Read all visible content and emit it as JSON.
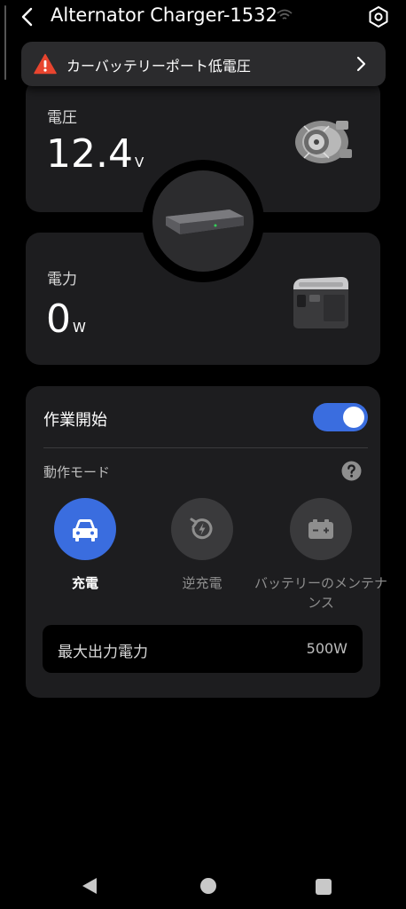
{
  "header": {
    "title": "Alternator Charger-1532"
  },
  "warning": {
    "text": "カーバッテリーポート低電圧"
  },
  "voltage": {
    "label": "電圧",
    "value": "12.4",
    "unit": "V"
  },
  "power": {
    "label": "電力",
    "value": "0",
    "unit": "W"
  },
  "work": {
    "label": "作業開始",
    "enabled": true,
    "mode_label": "動作モード",
    "modes": [
      {
        "label": "充電",
        "active": true
      },
      {
        "label": "逆充電",
        "active": false
      },
      {
        "label": "バッテリーのメンテナンス",
        "active": false
      }
    ],
    "max_output_label": "最大出力電力",
    "max_output_value": "500W"
  },
  "colors": {
    "accent": "#3a6ddf",
    "warning": "#e8452f",
    "card": "#1d1d1f"
  }
}
